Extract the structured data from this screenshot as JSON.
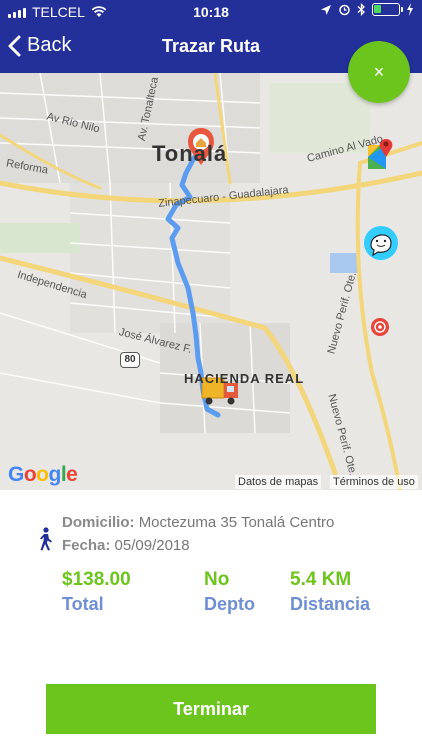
{
  "status_bar": {
    "carrier": "TELCEL",
    "time": "10:18",
    "battery_level": 0.3
  },
  "nav": {
    "back_label": "Back",
    "title": "Trazar Ruta"
  },
  "close_button": {
    "label": "×"
  },
  "map": {
    "labels": {
      "city": "Tonalá",
      "neighborhood": "HACIENDA REAL",
      "road_main": "Zinapecuaro - Guadalajara",
      "road_nilo": "Av Rio Nilo",
      "road_tonalteca": "Av. Tonalteca",
      "road_reforma": "Reforma",
      "road_independencia": "Independencia",
      "road_alvarez": "José Álvarez F.",
      "road_vado": "Camino Al Vado",
      "road_perif1": "Nuevo Perif. Ote.",
      "road_perif2": "Nuevo Perif. Ote.",
      "highway_shield": "80"
    },
    "google_letters": [
      "G",
      "o",
      "o",
      "g",
      "l",
      "e"
    ],
    "attribution_data": "Datos de mapas",
    "attribution_terms": "Términos de uso"
  },
  "info": {
    "address_label": "Domicilio:",
    "address_value": "Moctezuma 35 Tonalá Centro",
    "date_label": "Fecha:",
    "date_value": "05/09/2018",
    "stats": [
      {
        "value": "$138.00",
        "label": "Total"
      },
      {
        "value": "No",
        "label": "Depto"
      },
      {
        "value": "5.4 KM",
        "label": "Distancia"
      }
    ]
  },
  "finish_button": {
    "label": "Terminar"
  },
  "colors": {
    "nav_bg": "#24309a",
    "accent_green": "#6cc51d",
    "label_blue": "#6f8fd4",
    "route_blue": "#5b9bf0"
  }
}
